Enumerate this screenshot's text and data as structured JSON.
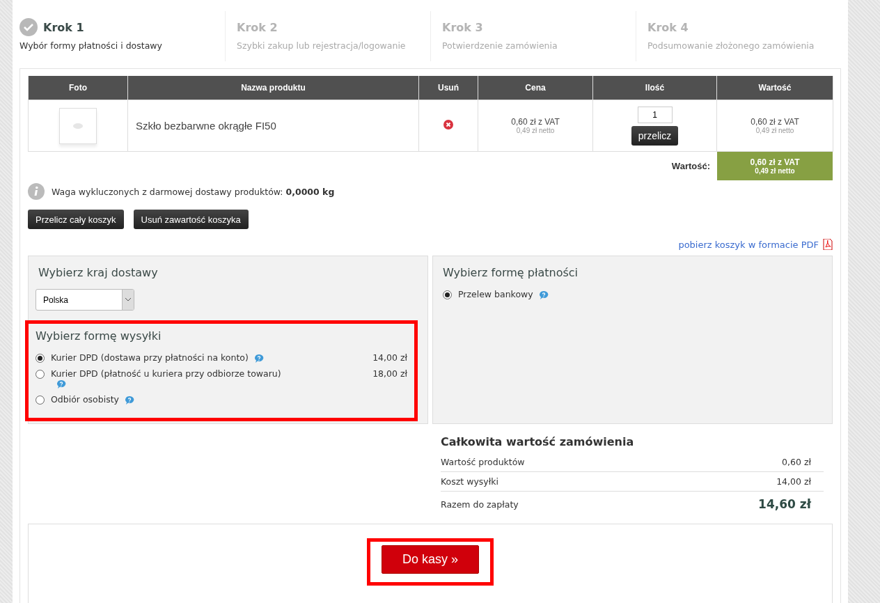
{
  "steps": [
    {
      "title": "Krok 1",
      "subtitle": "Wybór formy płatności i dostawy",
      "done": true
    },
    {
      "title": "Krok 2",
      "subtitle": "Szybki zakup lub rejestracja/logowanie",
      "done": false
    },
    {
      "title": "Krok 3",
      "subtitle": "Potwierdzenie zamówienia",
      "done": false
    },
    {
      "title": "Krok 4",
      "subtitle": "Podsumowanie złożonego zamówienia",
      "done": false
    }
  ],
  "cart_table": {
    "columns": [
      "Foto",
      "Nazwa produktu",
      "Usuń",
      "Cena",
      "Ilość",
      "Wartość"
    ],
    "rows": [
      {
        "name": "Szkło bezbarwne okrągłe FI50",
        "price_gross": "0,60 zł",
        "price_gross_suffix": "z VAT",
        "price_net": "0,49 zł",
        "price_net_suffix": "netto",
        "quantity": "1",
        "recalc_button": "przelicz",
        "value_gross": "0,60 zł",
        "value_gross_suffix": "z VAT",
        "value_net": "0,49 zł",
        "value_net_suffix": "netto"
      }
    ],
    "total_label": "Wartość:",
    "total_gross": "0,60 zł",
    "total_gross_suffix": "z VAT",
    "total_net": "0,49 zł",
    "total_net_suffix": "netto"
  },
  "weight_note": "Waga wykluczonych z darmowej dostawy produktów: **0,0000 kg**",
  "cart_buttons": [
    "Przelicz cały koszyk",
    "Usuń zawartość koszyka"
  ],
  "pdf_link": "pobierz koszyk w formacie PDF",
  "country": {
    "title": "Wybierz kraj dostawy",
    "value": "Polska"
  },
  "shipping": {
    "title": "Wybierz formę wysyłki",
    "highlighted": true,
    "options": [
      {
        "label": "Kurier DPD (dostawa przy płatności na konto)",
        "price": "14,00 zł",
        "selected": true
      },
      {
        "label": "Kurier DPD (płatność u kuriera przy odbiorze towaru)",
        "price": "18,00 zł",
        "selected": false
      },
      {
        "label": "Odbiór osobisty",
        "selected": false
      }
    ]
  },
  "payment": {
    "title": "Wybierz formę płatności",
    "options": [
      {
        "label": "Przelew bankowy",
        "selected": true
      }
    ]
  },
  "summary": {
    "title": "Całkowita wartość zamówienia",
    "rows": [
      {
        "label": "Wartość produktów",
        "value": "0,60 zł",
        "kind": "line"
      },
      {
        "label": "Koszt wysyłki",
        "value": "14,00 zł",
        "kind": "line"
      },
      {
        "label": "Razem do zapłaty",
        "value": "14,60 zł",
        "kind": "total"
      }
    ]
  },
  "checkout": {
    "label": "Do kasy »",
    "highlighted": true
  }
}
